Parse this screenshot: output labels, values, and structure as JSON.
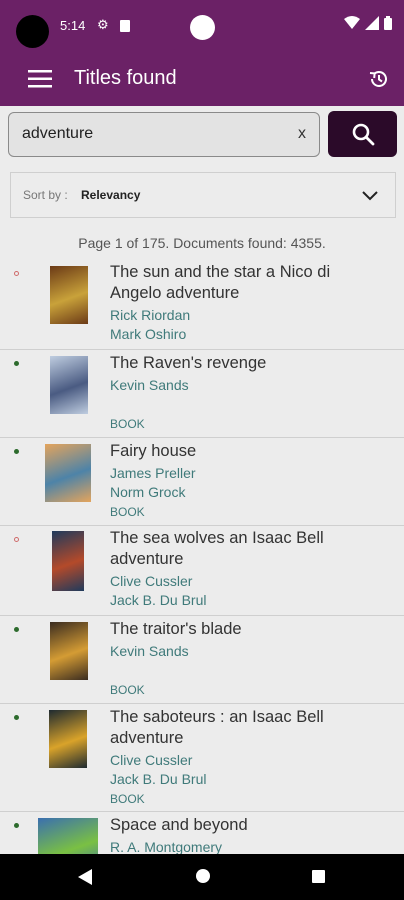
{
  "status_bar": {
    "time": "5:14"
  },
  "app_bar": {
    "title": "Titles found"
  },
  "search": {
    "value": "adventure",
    "clear_label": "x"
  },
  "sort": {
    "label": "Sort by :",
    "value": "Relevancy"
  },
  "page_info": "Page 1 of 175. Documents found: 4355.",
  "results": [
    {
      "title_lines": [
        "The sun and the star a Nico di",
        "Angelo adventure"
      ],
      "lines": [
        "Rick Riordan",
        "Mark Oshiro"
      ],
      "type": "",
      "bullet": "hollow",
      "cover_colors": [
        "#6b3a16",
        "#c9a23a"
      ]
    },
    {
      "title_lines": [
        "The Raven's revenge"
      ],
      "lines": [
        "Kevin Sands"
      ],
      "type": "BOOK",
      "bullet": "filled",
      "cover_colors": [
        "#bfcde0",
        "#4a5b82"
      ]
    },
    {
      "title_lines": [
        "Fairy house"
      ],
      "lines": [
        "James Preller",
        "Norm Grock"
      ],
      "type": "BOOK",
      "bullet": "filled",
      "cover_colors": [
        "#e4a45c",
        "#4d83a8"
      ]
    },
    {
      "title_lines": [
        "The sea wolves an Isaac Bell",
        "adventure"
      ],
      "lines": [
        "Clive Cussler",
        "Jack B. Du Brul"
      ],
      "type": "",
      "bullet": "hollow",
      "cover_colors": [
        "#1f3a5c",
        "#b44a2a"
      ]
    },
    {
      "title_lines": [
        "The traitor's blade"
      ],
      "lines": [
        "Kevin Sands"
      ],
      "type": "BOOK",
      "bullet": "filled",
      "cover_colors": [
        "#3a2c20",
        "#d49c34"
      ]
    },
    {
      "title_lines": [
        "The saboteurs : an Isaac Bell",
        "adventure"
      ],
      "lines": [
        "Clive Cussler",
        "Jack B. Du Brul"
      ],
      "type": "BOOK",
      "bullet": "filled",
      "cover_colors": [
        "#1e2a30",
        "#d9a32a"
      ]
    },
    {
      "title_lines": [
        "Space and beyond"
      ],
      "lines": [
        "R. A. Montgomery"
      ],
      "type": "",
      "bullet": "filled",
      "cover_colors": [
        "#3a6fb0",
        "#7ac043"
      ]
    }
  ],
  "colors": {
    "primary": "#6b2166",
    "search_button": "#2b0a29",
    "link": "#3f7a7a"
  },
  "icons": {
    "menu": "hamburger-icon",
    "history": "history-icon",
    "search": "search-icon",
    "sort": "chevron-down-icon"
  }
}
